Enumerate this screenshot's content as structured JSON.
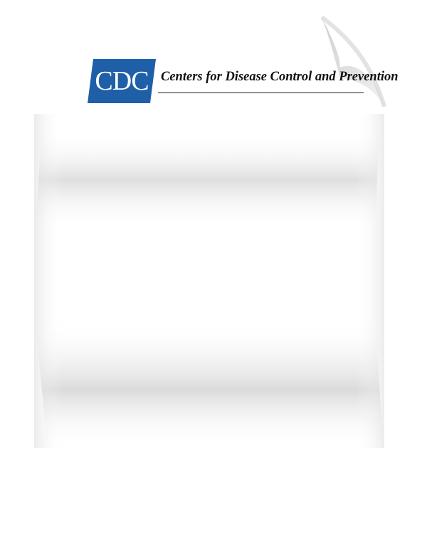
{
  "header": {
    "logo_text": "CDC",
    "org_name": "Centers for Disease Control and Prevention"
  },
  "colors": {
    "brand_blue": "#1f5fa8",
    "page_background": "#ffffff",
    "shadow_gray": "#d6d6d6"
  }
}
